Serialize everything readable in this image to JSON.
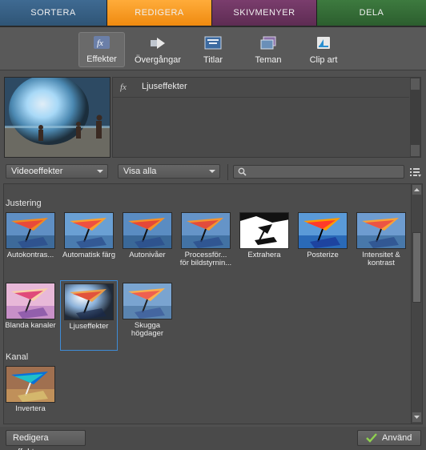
{
  "tabs": [
    {
      "label": "SORTERA"
    },
    {
      "label": "REDIGERA"
    },
    {
      "label": "SKIVMENYER"
    },
    {
      "label": "DELA"
    }
  ],
  "tools": [
    {
      "label": "Effekter",
      "icon": "fx-icon"
    },
    {
      "label": "Övergångar",
      "icon": "transition-icon"
    },
    {
      "label": "Titlar",
      "icon": "titles-icon"
    },
    {
      "label": "Teman",
      "icon": "themes-icon"
    },
    {
      "label": "Clip art",
      "icon": "clipart-icon"
    }
  ],
  "info": {
    "title": "Ljuseffekter"
  },
  "filters": {
    "category": "Videoeffekter",
    "show": "Visa alla",
    "search_placeholder": ""
  },
  "gallery": {
    "sections": [
      {
        "title": "Justering",
        "items": [
          {
            "label": "Autokontras..."
          },
          {
            "label": "Automatisk färg"
          },
          {
            "label": "Autonivåer"
          },
          {
            "label": "Processför... för bildstyrnin..."
          },
          {
            "label": "Extrahera"
          },
          {
            "label": "Posterize"
          },
          {
            "label": "Intensitet & kontrast"
          },
          {
            "label": "Blanda kanaler"
          },
          {
            "label": "Ljuseffekter"
          },
          {
            "label": "Skugga högdager"
          }
        ]
      },
      {
        "title": "Kanal",
        "items": [
          {
            "label": "Invertera"
          }
        ]
      }
    ]
  },
  "bottom": {
    "edit_effects": "Redigera effekter",
    "apply": "Använd"
  },
  "colors": {
    "tab_sort": "#35618a",
    "tab_edit": "#f79a20",
    "tab_disc": "#6b3360",
    "tab_share": "#357237",
    "selection": "#3e8bd6"
  }
}
